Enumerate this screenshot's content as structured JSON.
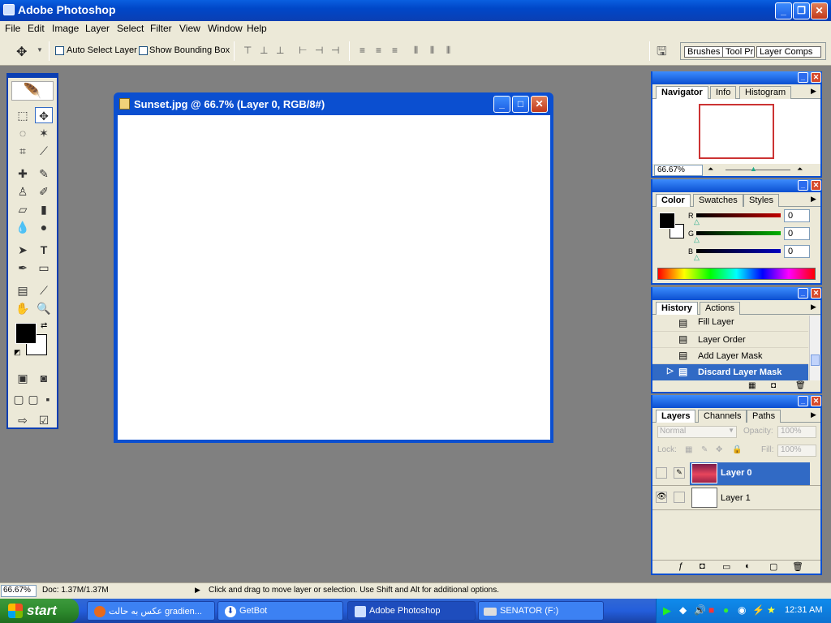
{
  "app": {
    "title": "Adobe Photoshop"
  },
  "menu": [
    "File",
    "Edit",
    "Image",
    "Layer",
    "Select",
    "Filter",
    "View",
    "Window",
    "Help"
  ],
  "options": {
    "auto_select": "Auto Select Layer",
    "show_bounding": "Show Bounding Box",
    "well_tabs": [
      "Brushes",
      "Tool Pr",
      "Layer Comps"
    ]
  },
  "document": {
    "title": "Sunset.jpg @ 66.7% (Layer 0, RGB/8#)"
  },
  "navigator": {
    "tabs": [
      "Navigator",
      "Info",
      "Histogram"
    ],
    "zoom": "66.67%"
  },
  "color": {
    "tabs": [
      "Color",
      "Swatches",
      "Styles"
    ],
    "channels": [
      {
        "label": "R",
        "value": "0",
        "color": "#c00000"
      },
      {
        "label": "G",
        "value": "0",
        "color": "#00b000"
      },
      {
        "label": "B",
        "value": "0",
        "color": "#0000c0"
      }
    ]
  },
  "history": {
    "tabs": [
      "History",
      "Actions"
    ],
    "items": [
      "Fill Layer",
      "Layer Order",
      "Add Layer Mask",
      "Discard Layer Mask"
    ],
    "selected": "Discard Layer Mask"
  },
  "layers": {
    "tabs": [
      "Layers",
      "Channels",
      "Paths"
    ],
    "blend_mode": "Normal",
    "opacity_label": "Opacity:",
    "opacity": "100%",
    "lock_label": "Lock:",
    "fill_label": "Fill:",
    "fill": "100%",
    "items": [
      {
        "name": "Layer 0"
      },
      {
        "name": "Layer 1"
      }
    ]
  },
  "status": {
    "zoom": "66.67%",
    "doc": "Doc: 1.37M/1.37M",
    "message": "Click and drag to move layer or selection.  Use Shift and Alt for additional options."
  },
  "taskbar": {
    "start": "start",
    "tasks": [
      "عکس به حالت gradien...",
      "GetBot",
      "Adobe Photoshop",
      "SENATOR (F:)"
    ],
    "clock": "12:31 AM"
  },
  "colors": {
    "accent": "#0b4fd0",
    "selection": "#316ac5"
  }
}
